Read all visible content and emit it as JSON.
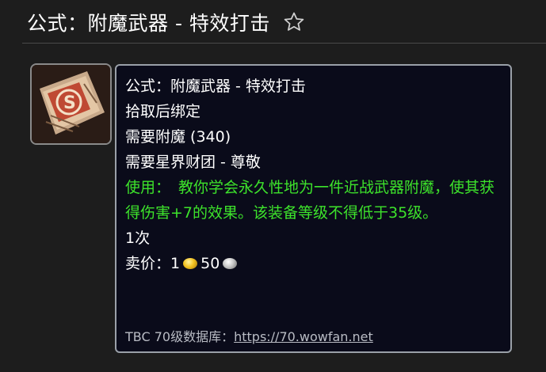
{
  "header": {
    "title": "公式：附魔武器 - 特效打击",
    "star_icon": "star-outline-icon"
  },
  "item": {
    "icon": "recipe-scroll-icon",
    "tooltip": {
      "name": "公式：附魔武器 - 特效打击",
      "bind": "拾取后绑定",
      "req_skill": "需要附魔 (340)",
      "req_rep": "需要星界财团 - 尊敬",
      "use_label": "使用：",
      "use_text": "教你学会永久性地为一件近战武器附魔，使其获得伤害+7的效果。该装备等级不得低于35级。",
      "charges": "1次",
      "sell_label": "卖价：",
      "sell_gold": "1",
      "sell_silver": "50",
      "footer_label": "TBC 70级数据库：",
      "footer_link": "https://70.wowfan.net"
    }
  },
  "colors": {
    "use_text": "#3de32b",
    "tooltip_bg": "#0a0b1a",
    "page_bg": "#1d1d1d"
  }
}
